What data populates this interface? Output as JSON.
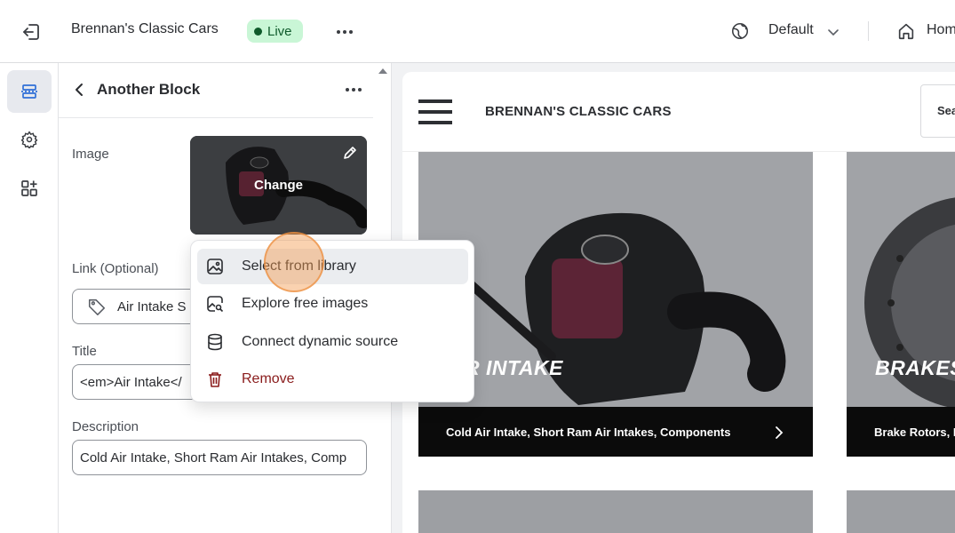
{
  "topbar": {
    "store_name": "Brennan's Classic Cars",
    "status": "Live",
    "locale": "Default",
    "home_label": "Home"
  },
  "panel": {
    "title": "Another Block",
    "image_label": "Image",
    "change_label": "Change",
    "link_label": "Link (Optional)",
    "link_value": "Air Intake S",
    "title_label": "Title",
    "title_value": "<em>Air Intake</",
    "description_label": "Description",
    "description_value": "Cold Air Intake, Short Ram Air Intakes, Comp"
  },
  "menu": {
    "items": [
      {
        "label": "Select from library",
        "icon": "image-icon"
      },
      {
        "label": "Explore free images",
        "icon": "image-search-icon"
      },
      {
        "label": "Connect dynamic source",
        "icon": "database-icon"
      },
      {
        "label": "Remove",
        "icon": "trash-icon"
      }
    ]
  },
  "preview": {
    "site_name": "BRENNAN'S CLASSIC CARS",
    "search_label": "Sea",
    "cards": [
      {
        "headline": "R INTAKE",
        "caption": "Cold Air Intake, Short Ram Air Intakes, Components"
      },
      {
        "headline": "BRAKES",
        "caption": "Brake Rotors, P"
      }
    ]
  },
  "colors": {
    "live_badge_bg": "#c9f6d6",
    "live_badge_text": "#0f5a2b",
    "remove_text": "#8a1c1c",
    "rail_active": "#e7e9ee",
    "cursor_highlight": "#f39c50"
  }
}
